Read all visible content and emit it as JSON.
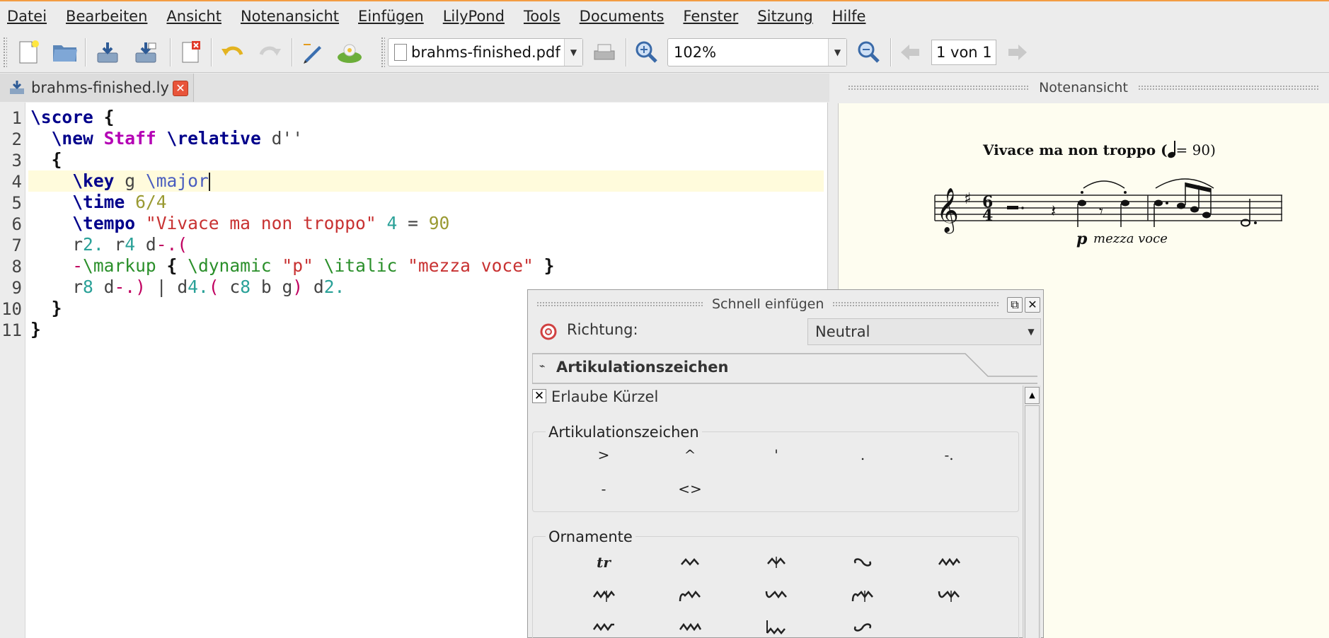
{
  "menu": [
    "Datei",
    "Bearbeiten",
    "Ansicht",
    "Notenansicht",
    "Einfügen",
    "LilyPond",
    "Tools",
    "Documents",
    "Fenster",
    "Sitzung",
    "Hilfe"
  ],
  "toolbar": {
    "document_combo": "brahms-finished.pdf",
    "zoom": "102%",
    "page": "1 von 1",
    "icons": [
      "new-document-icon",
      "open-folder-icon",
      "save-icon",
      "save-as-icon",
      "close-document-icon",
      "undo-icon",
      "redo-icon",
      "edit-icon",
      "lilypond-run-icon",
      "print-icon",
      "zoom-in-icon",
      "zoom-out-icon",
      "previous-page-icon",
      "next-page-icon"
    ]
  },
  "editor": {
    "tab_label": "brahms-finished.ly",
    "line_numbers": [
      "1",
      "2",
      "3",
      "4",
      "5",
      "6",
      "7",
      "8",
      "9",
      "10",
      "11"
    ]
  },
  "music_view": {
    "title": "Notenansicht",
    "tempo_text": "Vivace ma non troppo (",
    "tempo_value": "= 90)",
    "dynamic": "p",
    "expression": "mezza voce",
    "time_sig_top": "6",
    "time_sig_bottom": "4"
  },
  "quick_insert": {
    "title": "Schnell einfügen",
    "direction_label": "Richtung:",
    "direction_value": "Neutral",
    "tab_label": "Artikulationszeichen",
    "checkbox_label": "Erlaube Kürzel",
    "checkbox_checked": true,
    "articulations_title": "Artikulationszeichen",
    "articulations": [
      ">",
      "^",
      "'",
      ".",
      "-.",
      "-",
      "<>"
    ],
    "ornaments_title": "Ornamente",
    "ornaments": [
      "tr",
      "prall",
      "mordent",
      "turn",
      "prallprall",
      "prallmordent",
      "upprall",
      "downprall",
      "upmordent",
      "downmordent",
      "prallup",
      "pralldown",
      "lineprall",
      "reverseturn"
    ]
  },
  "colors": {
    "accent_border": "#f39c43",
    "score_background": "#fefdf0",
    "current_line": "#fffbdc"
  }
}
